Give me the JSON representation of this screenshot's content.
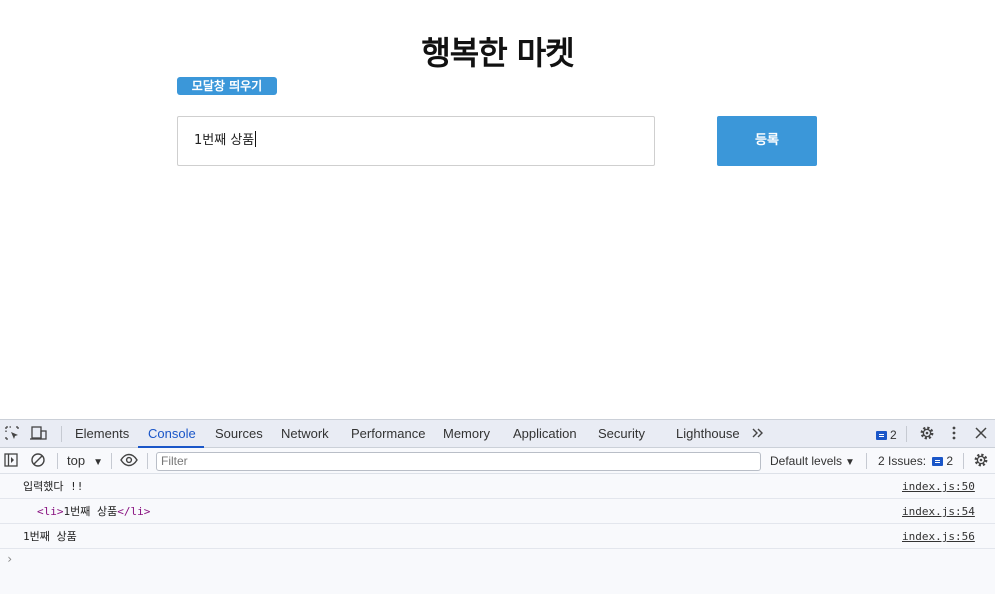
{
  "page": {
    "title": "행복한 마켓",
    "modal_button": "모달창 띄우기",
    "input_value": "1번째 상품",
    "register_button": "등록"
  },
  "devtools": {
    "tabs": [
      {
        "label": "Elements"
      },
      {
        "label": "Console"
      },
      {
        "label": "Sources"
      },
      {
        "label": "Network"
      },
      {
        "label": "Performance"
      },
      {
        "label": "Memory"
      },
      {
        "label": "Application"
      },
      {
        "label": "Security"
      },
      {
        "label": "Lighthouse"
      }
    ],
    "active_tab": "Console",
    "message_badge_count": "2",
    "context": "top",
    "filter_placeholder": "Filter",
    "levels": "Default levels",
    "issues_label": "2 Issues:",
    "issues_count": "2",
    "logs": [
      {
        "text": "입력했다 !!",
        "source": "index.js:50"
      },
      {
        "tag_open": "<li>",
        "text": "1번째 상품",
        "tag_close": "</li>",
        "source": "index.js:54"
      },
      {
        "text": "1번째 상품",
        "source": "index.js:56"
      }
    ],
    "prompt": "›"
  },
  "colors": {
    "button_blue": "#3b97d9",
    "active_tab": "#1a56c8",
    "tag_purple": "#881280"
  }
}
